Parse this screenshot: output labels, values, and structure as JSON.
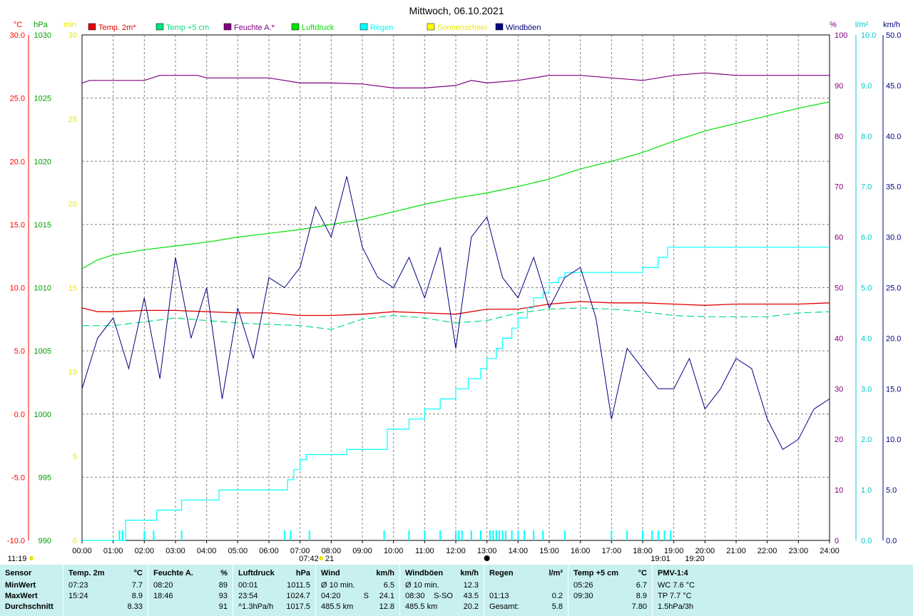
{
  "chart_data": {
    "type": "line",
    "title": "Mittwoch, 06.10.2021",
    "x_ticks": [
      "00:00",
      "01:00",
      "02:00",
      "03:00",
      "04:00",
      "05:00",
      "06:00",
      "07:00",
      "08:00",
      "09:00",
      "10:00",
      "11:00",
      "12:00",
      "13:00",
      "14:00",
      "15:00",
      "16:00",
      "17:00",
      "18:00",
      "19:00",
      "20:00",
      "21:00",
      "22:00",
      "23:00",
      "24:00"
    ],
    "sun_events": {
      "sunrise": "07:42",
      "sunrise_min": "21",
      "noon_marker": "13:00",
      "sunset": "19:01",
      "sunset2": "19:20"
    },
    "axes": {
      "temp": {
        "unit": "°C",
        "min": -10,
        "max": 30,
        "ticks": [
          "30.0",
          "25.0",
          "20.0",
          "15.0",
          "10.0",
          "5.0",
          "0.0",
          "-5.0",
          "-10.0"
        ],
        "color": "#ff0000"
      },
      "pressure": {
        "unit": "hPa",
        "min": 990,
        "max": 1030,
        "ticks": [
          "1030",
          "1025",
          "1020",
          "1015",
          "1010",
          "1005",
          "1000",
          "995",
          "990"
        ],
        "color": "#00a000"
      },
      "sunshine": {
        "unit": "min",
        "min": 0,
        "max": 30,
        "ticks": [
          "30",
          "25",
          "20",
          "15",
          "10",
          "5",
          "0"
        ],
        "color": "#e8e800"
      },
      "humidity": {
        "unit": "%",
        "min": 0,
        "max": 100,
        "ticks": [
          "100",
          "90",
          "80",
          "70",
          "60",
          "50",
          "40",
          "30",
          "20",
          "10",
          "0"
        ],
        "color": "#800080"
      },
      "rain": {
        "unit": "l/m²",
        "min": 0,
        "max": 10,
        "ticks": [
          "10.0",
          "9.0",
          "8.0",
          "7.0",
          "6.0",
          "5.0",
          "4.0",
          "3.0",
          "2.0",
          "1.0",
          "0.0"
        ],
        "color": "#00c8c8"
      },
      "wind": {
        "unit": "km/h",
        "min": 0,
        "max": 50,
        "ticks": [
          "50.0",
          "45.0",
          "40.0",
          "35.0",
          "30.0",
          "25.0",
          "20.0",
          "15.0",
          "10.0",
          "5.0",
          "0.0"
        ],
        "color": "#000080"
      }
    },
    "legend": [
      {
        "name": "Temp. 2m*",
        "color": "#e00000"
      },
      {
        "name": "Temp +5 cm",
        "color": "#00e080"
      },
      {
        "name": "Feuchte A.*",
        "color": "#800080"
      },
      {
        "name": "Luftdruck",
        "color": "#00e000"
      },
      {
        "name": "Regen",
        "color": "#00ffff"
      },
      {
        "name": "Sonnenschein",
        "color": "#ffff00"
      },
      {
        "name": "Windböen",
        "color": "#000080"
      }
    ],
    "series": [
      {
        "name": "Temp. 2m*",
        "axis": "temp",
        "x": [
          0,
          0.5,
          1,
          2,
          3,
          4,
          5,
          6,
          7,
          8,
          9,
          10,
          11,
          12,
          13,
          14,
          15,
          16,
          17,
          18,
          19,
          20,
          21,
          22,
          23,
          24
        ],
        "values": [
          8.4,
          8.1,
          8.1,
          8.2,
          8.2,
          8.1,
          8.0,
          8.0,
          7.8,
          7.8,
          7.9,
          8.1,
          8.0,
          7.9,
          8.3,
          8.3,
          8.7,
          8.9,
          8.8,
          8.8,
          8.7,
          8.6,
          8.7,
          8.7,
          8.7,
          8.8
        ]
      },
      {
        "name": "Temp +5 cm",
        "axis": "temp",
        "x": [
          0,
          1,
          2,
          3,
          4,
          5,
          6,
          7,
          8,
          9,
          10,
          11,
          12,
          13,
          14,
          15,
          16,
          17,
          18,
          19,
          20,
          21,
          22,
          23,
          24
        ],
        "values": [
          7.0,
          7.0,
          7.3,
          7.6,
          7.4,
          7.2,
          7.1,
          7.0,
          6.7,
          7.5,
          7.8,
          7.6,
          7.2,
          7.4,
          8.0,
          8.3,
          8.4,
          8.3,
          8.1,
          7.8,
          7.7,
          7.7,
          7.7,
          8.0,
          8.1
        ]
      },
      {
        "name": "Feuchte A.*",
        "axis": "humidity",
        "x": [
          0,
          0.25,
          1,
          2,
          2.5,
          3.7,
          4,
          5.5,
          6,
          7,
          8,
          9,
          10,
          11,
          12,
          12.5,
          13,
          14,
          15,
          16,
          17,
          18,
          19,
          20,
          21,
          22,
          23,
          24
        ],
        "values": [
          90.5,
          91,
          91,
          91,
          92,
          92,
          91.5,
          91.5,
          91.5,
          90.5,
          90.5,
          90.3,
          89.5,
          89.5,
          90,
          91,
          90.5,
          91,
          92,
          92,
          91.5,
          91,
          92,
          92.5,
          92,
          92,
          92,
          92
        ]
      },
      {
        "name": "Luftdruck",
        "axis": "pressure",
        "x": [
          0,
          0.5,
          1,
          2,
          3,
          4,
          5,
          6,
          7,
          8,
          9,
          10,
          11,
          12,
          13,
          14,
          15,
          16,
          17,
          18,
          19,
          20,
          21,
          22,
          23,
          24
        ],
        "values": [
          1011.5,
          1012.2,
          1012.6,
          1013.0,
          1013.3,
          1013.6,
          1014.0,
          1014.3,
          1014.6,
          1015.0,
          1015.4,
          1016.0,
          1016.6,
          1017.1,
          1017.5,
          1018.0,
          1018.6,
          1019.4,
          1020.0,
          1020.7,
          1021.6,
          1022.4,
          1023.0,
          1023.6,
          1024.2,
          1024.7
        ]
      },
      {
        "name": "Regen",
        "axis": "rain",
        "x": [
          0,
          1.2,
          1.4,
          2,
          2.4,
          3.2,
          4.4,
          6.6,
          6.8,
          7.0,
          7.2,
          8.5,
          9.8,
          10.5,
          11.0,
          11.5,
          12.0,
          12.4,
          12.8,
          13.0,
          13.3,
          13.5,
          13.8,
          14.0,
          14.3,
          14.5,
          14.8,
          15.0,
          15.3,
          15.5,
          16.5,
          17.0,
          17.5,
          18.0,
          18.3,
          18.5,
          18.8,
          19.0,
          24
        ],
        "values": [
          0,
          0,
          0.4,
          0.4,
          0.6,
          0.8,
          1.0,
          1.2,
          1.4,
          1.6,
          1.7,
          1.8,
          2.2,
          2.4,
          2.6,
          2.8,
          3.0,
          3.2,
          3.4,
          3.6,
          3.8,
          4.0,
          4.2,
          4.4,
          4.6,
          4.8,
          4.9,
          5.1,
          5.2,
          5.3,
          5.3,
          5.3,
          5.3,
          5.4,
          5.4,
          5.6,
          5.8,
          5.8,
          5.8
        ]
      },
      {
        "name": "Windböen",
        "axis": "wind",
        "x": [
          0,
          0.5,
          1,
          1.5,
          2,
          2.5,
          3,
          3.5,
          4,
          4.5,
          5,
          5.5,
          6,
          6.5,
          7,
          7.5,
          8,
          8.5,
          9,
          9.5,
          10,
          10.5,
          11,
          11.5,
          12,
          12.5,
          13,
          13.5,
          14,
          14.5,
          15,
          15.5,
          16,
          16.5,
          17,
          17.5,
          18,
          18.5,
          19,
          19.5,
          20,
          20.5,
          21,
          21.5,
          22,
          22.5,
          23,
          23.5,
          24
        ],
        "values": [
          15,
          20,
          22,
          17,
          24,
          16,
          28,
          20,
          25,
          14,
          23,
          18,
          26,
          25,
          27,
          33,
          30,
          36,
          29,
          26,
          25,
          28,
          24,
          29,
          19,
          30,
          32,
          26,
          24,
          28,
          23,
          26,
          27,
          22,
          12,
          19,
          17,
          15,
          15,
          18,
          13,
          15,
          18,
          17,
          12,
          9,
          10,
          13,
          14
        ]
      }
    ],
    "rain_events_hours": [
      1.2,
      1.3,
      2.0,
      2.3,
      3.2,
      6.5,
      6.7,
      7.3,
      9.7,
      10.5,
      11.0,
      11.5,
      12.0,
      12.1,
      12.2,
      12.5,
      12.8,
      13.1,
      13.2,
      13.3,
      13.4,
      13.5,
      13.6,
      13.8,
      14.0,
      14.2,
      14.5,
      14.8,
      15.5,
      17.0,
      17.5,
      18.0,
      18.3,
      18.5,
      18.7,
      18.9
    ]
  },
  "stats": {
    "columns": [
      {
        "title": "Sensor",
        "unit": "",
        "rows": [
          [
            "MinWert",
            "",
            ""
          ],
          [
            "MaxWert",
            "",
            ""
          ],
          [
            "Durchschnitt",
            "",
            ""
          ]
        ]
      },
      {
        "title": "Temp. 2m",
        "unit": "°C",
        "rows": [
          [
            "07:23",
            "",
            "7.7"
          ],
          [
            "15:24",
            "",
            "8.9"
          ],
          [
            "",
            "",
            "8.33"
          ]
        ]
      },
      {
        "title": "Feuchte A.",
        "unit": "%",
        "rows": [
          [
            "08:20",
            "",
            "89"
          ],
          [
            "18:46",
            "",
            "93"
          ],
          [
            "",
            "",
            "91"
          ]
        ]
      },
      {
        "title": "Luftdruck",
        "unit": "hPa",
        "rows": [
          [
            "00:01",
            "",
            "1011.5"
          ],
          [
            "23:54",
            "",
            "1024.7"
          ],
          [
            "^1.3hPa/h",
            "",
            "1017.5"
          ]
        ]
      },
      {
        "title": "Wind",
        "unit": "km/h",
        "rows": [
          [
            "Ø 10 min.",
            "",
            "6.5"
          ],
          [
            "04:20",
            "S",
            "24.1"
          ],
          [
            "485.5 km",
            "",
            "12.8"
          ]
        ]
      },
      {
        "title": "Windböen",
        "unit": "km/h",
        "rows": [
          [
            "Ø 10 min.",
            "",
            "12.3"
          ],
          [
            "08:30",
            "S-SO",
            "43.5"
          ],
          [
            "485.5 km",
            "",
            "20.2"
          ]
        ]
      },
      {
        "title": "Regen",
        "unit": "l/m²",
        "rows": [
          [
            "",
            "",
            ""
          ],
          [
            "01:13",
            "",
            "0.2"
          ],
          [
            "Gesamt:",
            "",
            "5.8"
          ]
        ]
      },
      {
        "title": "Temp +5 cm",
        "unit": "°C",
        "rows": [
          [
            "05:26",
            "",
            "6.7"
          ],
          [
            "09:30",
            "",
            "8.9"
          ],
          [
            "",
            "",
            "7.80"
          ]
        ]
      },
      {
        "title": "PMV-1:4",
        "unit": "",
        "rows": [
          [
            "WC 7.6 °C",
            "",
            ""
          ],
          [
            "TP 7.7 °C",
            "",
            ""
          ],
          [
            "1.5hPa/3h",
            "",
            ""
          ]
        ]
      }
    ],
    "time_label": "11:19"
  }
}
